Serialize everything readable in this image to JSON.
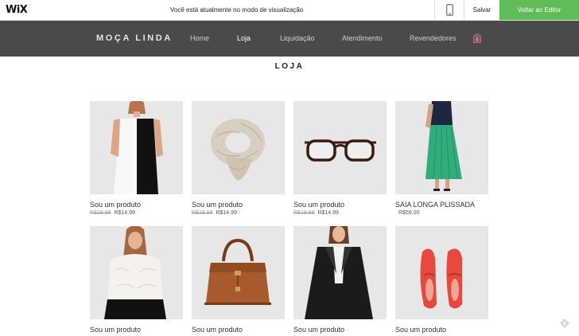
{
  "topbar": {
    "logo": "WiX",
    "preview_message": "Você está atualmente no modo de visualização",
    "save_label": "Salvar",
    "back_label": "Voltar ao Editor"
  },
  "header": {
    "brand": "MOÇA LINDA",
    "nav": [
      "Home",
      "Loja",
      "Liquidação",
      "Atendimento",
      "Revendedores"
    ],
    "active_nav": "Loja"
  },
  "page": {
    "title": "LOJA"
  },
  "products": [
    {
      "name": "Sou um produto",
      "old_price": "R$19.99",
      "price": "R$14.99",
      "image": "black-white-dress"
    },
    {
      "name": "Sou um produto",
      "old_price": "R$19.99",
      "price": "R$14.99",
      "image": "knit-scarf"
    },
    {
      "name": "Sou um produto",
      "old_price": "R$19.99",
      "price": "R$14.99",
      "image": "eyeglasses"
    },
    {
      "name": "SAIA LONGA PLISSADA",
      "old_price": "",
      "price": "R$59.00",
      "image": "green-pleated-skirt"
    },
    {
      "name": "Sou um produto",
      "old_price": "",
      "price": "",
      "image": "lace-blouse"
    },
    {
      "name": "Sou um produto",
      "old_price": "",
      "price": "",
      "image": "brown-handbag"
    },
    {
      "name": "Sou um produto",
      "old_price": "",
      "price": "",
      "image": "black-coat"
    },
    {
      "name": "Sou um produto",
      "old_price": "",
      "price": "",
      "image": "red-loafers"
    }
  ],
  "colors": {
    "accent_green": "#60bc57",
    "header_bg": "#4a4a4a",
    "thumb_bg": "#e7e7e7"
  }
}
